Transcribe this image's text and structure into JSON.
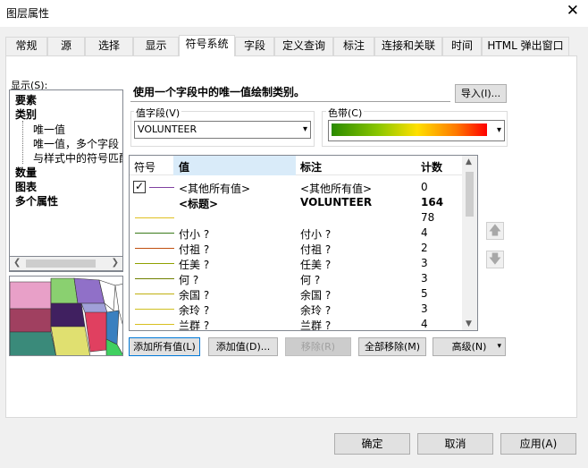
{
  "window": {
    "title": "图层属性",
    "close_glyph": "✕"
  },
  "tabs": [
    "常规",
    "源",
    "选择",
    "显示",
    "符号系统",
    "字段",
    "定义查询",
    "标注",
    "连接和关联",
    "时间",
    "HTML 弹出窗口"
  ],
  "show": {
    "label": "显示(S):",
    "items": [
      {
        "text": "要素",
        "bold": true
      },
      {
        "text": "类别",
        "bold": true
      },
      {
        "text": "唯一值",
        "bold": false
      },
      {
        "text": "唯一值，多个字段",
        "bold": false
      },
      {
        "text": "与样式中的符号匹配",
        "bold": false
      },
      {
        "text": "数量",
        "bold": true
      },
      {
        "text": "图表",
        "bold": true
      },
      {
        "text": "多个属性",
        "bold": true
      }
    ]
  },
  "description": "使用一个字段中的唯一值绘制类别。",
  "import_button": "导入(I)...",
  "value_field": {
    "label": "值字段(V)",
    "value": "VOLUNTEER"
  },
  "color_ramp": {
    "label": "色带(C)"
  },
  "grid": {
    "headers": {
      "symbol": "符号",
      "value": "值",
      "label": "标注",
      "count": "计数"
    },
    "rows": [
      {
        "value": "<其他所有值>",
        "label": "<其他所有值>",
        "count": "0",
        "bold": false,
        "color": "#8040a0",
        "checkbox": true
      },
      {
        "value": "<标题>",
        "label": "VOLUNTEER",
        "count": "164",
        "bold": true,
        "color": "",
        "checkbox": false
      },
      {
        "value": "",
        "label": "",
        "count": "78",
        "bold": false,
        "color": "#e0c020",
        "checkbox": false
      },
      {
        "value": "付小 ?",
        "label": "付小 ?",
        "count": "4",
        "bold": false,
        "color": "#3a7a1a",
        "checkbox": false
      },
      {
        "value": "付祖 ?",
        "label": "付祖 ?",
        "count": "2",
        "bold": false,
        "color": "#c05010",
        "checkbox": false
      },
      {
        "value": "任美 ?",
        "label": "任美 ?",
        "count": "3",
        "bold": false,
        "color": "#90a000",
        "checkbox": false
      },
      {
        "value": "何  ?",
        "label": "何  ?",
        "count": "3",
        "bold": false,
        "color": "#708000",
        "checkbox": false
      },
      {
        "value": "余国 ?",
        "label": "余国 ?",
        "count": "5",
        "bold": false,
        "color": "#c0b010",
        "checkbox": false
      },
      {
        "value": "余玲 ?",
        "label": "余玲 ?",
        "count": "3",
        "bold": false,
        "color": "#d0c020",
        "checkbox": false
      },
      {
        "value": "兰群 ?",
        "label": "兰群 ?",
        "count": "4",
        "bold": false,
        "color": "#d8c020",
        "checkbox": false
      }
    ]
  },
  "buttons": {
    "add_all": "添加所有值(L)",
    "add": "添加值(D)...",
    "remove": "移除(R)",
    "remove_all": "全部移除(M)",
    "advanced": "高级(N)",
    "ok": "确定",
    "cancel": "取消",
    "apply": "应用(A)"
  }
}
